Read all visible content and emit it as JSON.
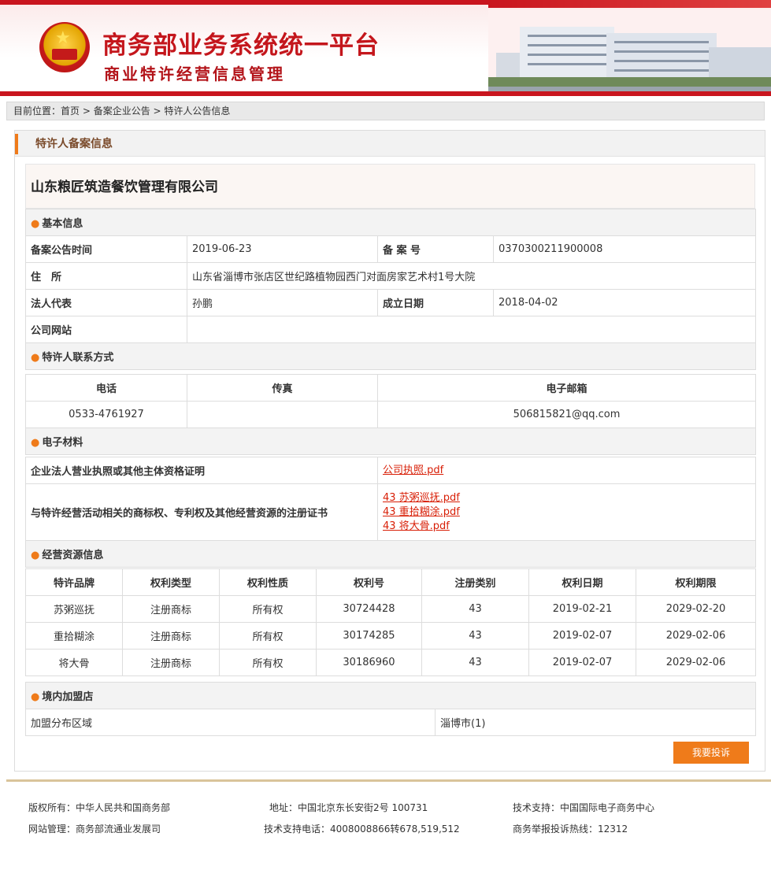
{
  "header": {
    "title": "商务部业务系统统一平台",
    "subtitle": "商业特许经营信息管理"
  },
  "breadcrumb": {
    "prefix": "目前位置：",
    "home": "首页",
    "sep1": " > ",
    "section": "备案企业公告",
    "sep2": " > ",
    "current": "特许人公告信息"
  },
  "panel": {
    "title": "特许人备案信息"
  },
  "company": {
    "name": "山东粮匠筑造餐饮管理有限公司"
  },
  "basic": {
    "section": "基本信息",
    "date_label": "备案公告时间",
    "date_value": "2019-06-23",
    "no_label": "备 案 号",
    "no_value": "0370300211900008",
    "addr_label": "住　所",
    "addr_value": "山东省淄博市张店区世纪路植物园西门对面房家艺术村1号大院",
    "legal_label": "法人代表",
    "legal_value": "孙鹏",
    "founded_label": "成立日期",
    "founded_value": "2018-04-02",
    "site_label": "公司网站",
    "site_value": ""
  },
  "contact": {
    "section": "特许人联系方式",
    "headers": [
      "电话",
      "传真",
      "电子邮箱"
    ],
    "values": [
      "0533-4761927",
      "",
      "506815821@qq.com"
    ]
  },
  "materials": {
    "section": "电子材料",
    "license_label": "企业法人营业执照或其他主体资格证明",
    "license_file": "公司执照.pdf",
    "trademark_label": "与特许经营活动相关的商标权、专利权及其他经营资源的注册证书",
    "trademark_files": [
      "43 苏粥巡抚.pdf",
      "43 重拾糊涂.pdf",
      "43 将大骨.pdf"
    ]
  },
  "resources": {
    "section": "经营资源信息",
    "headers": [
      "特许品牌",
      "权利类型",
      "权利性质",
      "权利号",
      "注册类别",
      "权利日期",
      "权利期限"
    ],
    "rows": [
      [
        "苏粥巡抚",
        "注册商标",
        "所有权",
        "30724428",
        "43",
        "2019-02-21",
        "2029-02-20"
      ],
      [
        "重拾糊涂",
        "注册商标",
        "所有权",
        "30174285",
        "43",
        "2019-02-07",
        "2029-02-06"
      ],
      [
        "将大骨",
        "注册商标",
        "所有权",
        "30186960",
        "43",
        "2019-02-07",
        "2029-02-06"
      ]
    ]
  },
  "stores": {
    "section": "境内加盟店",
    "area_label": "加盟分布区域",
    "area_value": "淄博市(1)"
  },
  "complain_button": "我要投诉",
  "footer": {
    "copyright": "版权所有：中华人民共和国商务部",
    "address": "地址：中国北京东长安街2号 100731",
    "tech": "技术支持：中国国际电子商务中心",
    "manager": "网站管理：商务部流通业发展司",
    "phone": "技术支持电话：4008008866转678,519,512",
    "hotline": "商务举报投诉热线：12312"
  },
  "colors": {
    "brand_red": "#c4161c",
    "accent_orange": "#ef7b1a",
    "link_red": "#d81e06"
  }
}
